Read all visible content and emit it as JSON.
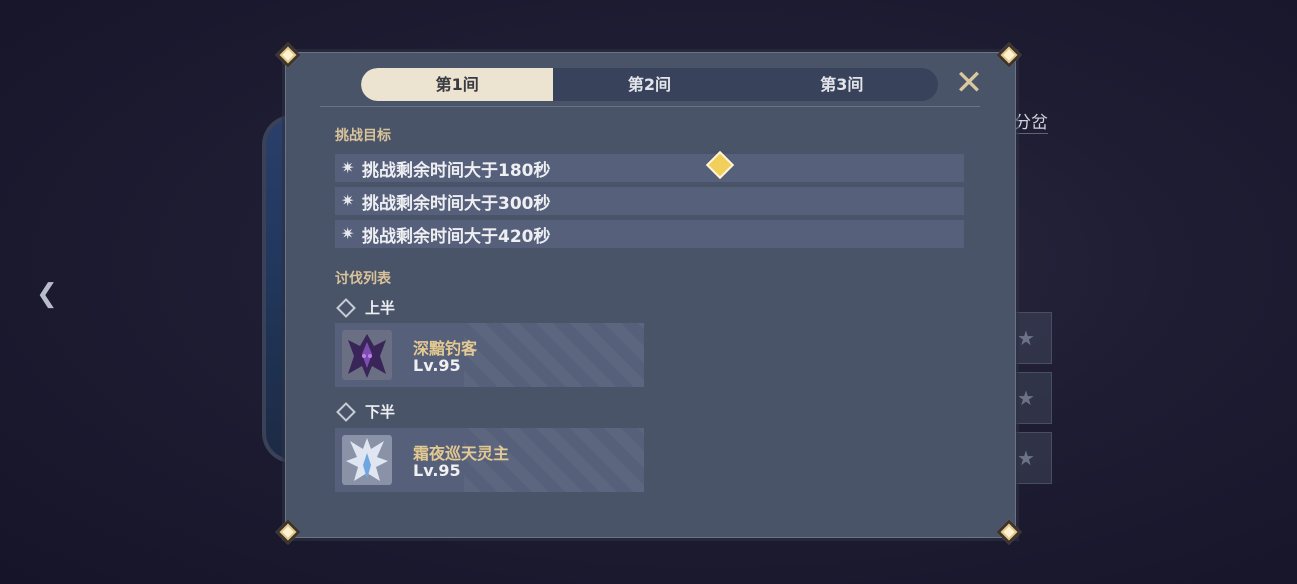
{
  "background": {
    "side_label": "分岔",
    "star_glyph": "★"
  },
  "tabs": [
    {
      "label": "第1间",
      "active": true
    },
    {
      "label": "第2间",
      "active": false
    },
    {
      "label": "第3间",
      "active": false
    }
  ],
  "challenge": {
    "title": "挑战目标",
    "goals": [
      "挑战剩余时间大于180秒",
      "挑战剩余时间大于300秒",
      "挑战剩余时间大于420秒"
    ]
  },
  "enemies": {
    "title": "讨伐列表",
    "halves": [
      {
        "label": "上半",
        "enemy": {
          "name": "深黯钓客",
          "level": "Lv.95"
        }
      },
      {
        "label": "下半",
        "enemy": {
          "name": "霜夜巡天灵主",
          "level": "Lv.95"
        }
      }
    ]
  },
  "icons": {
    "back": "back-chevron-icon",
    "close": "close-icon",
    "goal": "star-badge-icon",
    "half": "diamond-icon"
  },
  "colors": {
    "panel": "#4a5468",
    "gold_text": "#d8c39a",
    "active_tab": "#ece4d0"
  }
}
